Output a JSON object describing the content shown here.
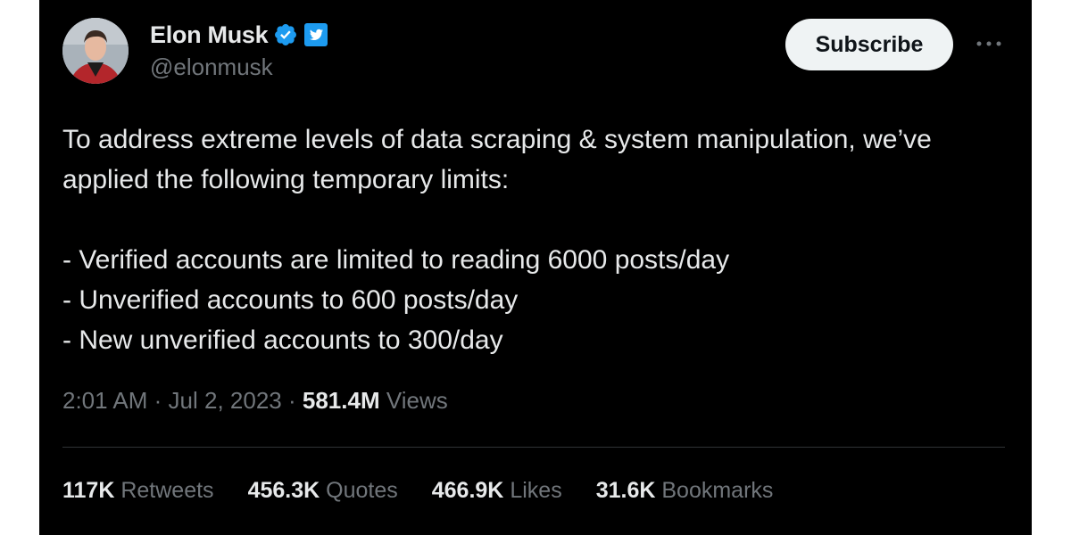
{
  "author": {
    "display_name": "Elon Musk",
    "handle": "@elonmusk",
    "verified_badge_icon": "verified-check-icon",
    "affiliate_badge_icon": "twitter-bird-icon"
  },
  "actions": {
    "subscribe_label": "Subscribe",
    "more_icon": "more-dots-icon"
  },
  "tweet": {
    "text": "To address extreme levels of data scraping & system manipulation, we’ve applied the following temporary limits:\n\n- Verified accounts are limited to reading 6000 posts/day\n- Unverified accounts to 600 posts/day\n- New unverified accounts to 300/day",
    "time": "2:01 AM",
    "date": "Jul 2, 2023",
    "views_count": "581.4M",
    "views_label": "Views"
  },
  "stats": [
    {
      "count": "117K",
      "label": "Retweets"
    },
    {
      "count": "456.3K",
      "label": "Quotes"
    },
    {
      "count": "466.9K",
      "label": "Likes"
    },
    {
      "count": "31.6K",
      "label": "Bookmarks"
    }
  ],
  "colors": {
    "background": "#000000",
    "text_primary": "#e7e9ea",
    "text_secondary": "#71767b",
    "verified_blue": "#1d9bf0",
    "button_bg": "#eff3f4"
  }
}
